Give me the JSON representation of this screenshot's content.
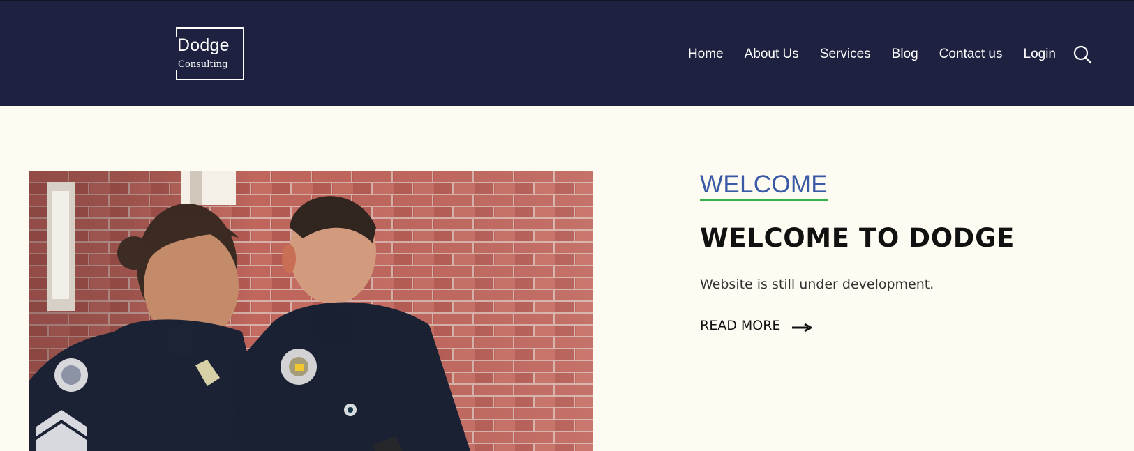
{
  "header": {
    "logo_title": "Dodge",
    "logo_subtitle": "Consulting",
    "nav": [
      {
        "label": "Home"
      },
      {
        "label": "About Us"
      },
      {
        "label": "Services"
      },
      {
        "label": "Blog"
      },
      {
        "label": "Contact us"
      },
      {
        "label": "Login"
      }
    ],
    "search_icon": "search-icon"
  },
  "hero": {
    "image_alt": "Two police officers reviewing a phone in front of a brick wall",
    "eyebrow": "WELCOME",
    "headline": "WELCOME TO DODGE",
    "description": "Website is still under development.",
    "read_more": "READ MORE",
    "arrow_icon": "arrow-right-icon"
  },
  "colors": {
    "header_bg": "#1e2140",
    "page_bg": "#fefcf2",
    "eyebrow": "#3a5aa6",
    "eyebrow_underline": "#35b34a",
    "headline": "#111111"
  }
}
